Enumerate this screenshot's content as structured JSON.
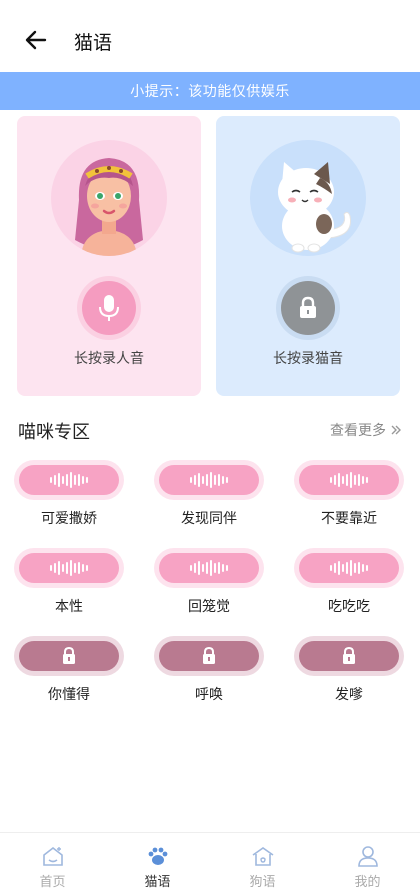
{
  "header": {
    "title": "猫语"
  },
  "tip": "小提示：该功能仅供娱乐",
  "record_cards": [
    {
      "label": "长按录人音",
      "icon": "microphone-icon"
    },
    {
      "label": "长按录猫音",
      "icon": "lock-icon"
    }
  ],
  "section": {
    "title": "喵咪专区",
    "more": "查看更多"
  },
  "sounds": [
    {
      "label": "可爱撒娇",
      "locked": false
    },
    {
      "label": "发现同伴",
      "locked": false
    },
    {
      "label": "不要靠近",
      "locked": false
    },
    {
      "label": "本性",
      "locked": false
    },
    {
      "label": "回笼觉",
      "locked": false
    },
    {
      "label": "吃吃吃",
      "locked": false
    },
    {
      "label": "你懂得",
      "locked": true
    },
    {
      "label": "呼唤",
      "locked": true
    },
    {
      "label": "发嗲",
      "locked": true
    }
  ],
  "tabs": [
    {
      "label": "首页",
      "icon": "home-icon",
      "active": false
    },
    {
      "label": "猫语",
      "icon": "paw-icon",
      "active": true
    },
    {
      "label": "狗语",
      "icon": "dog-house-icon",
      "active": false
    },
    {
      "label": "我的",
      "icon": "user-icon",
      "active": false
    }
  ],
  "colors": {
    "tip_bar": "#7fb2ff",
    "pink": "#f7a3c4",
    "locked": "#b97a90",
    "active_tab": "#333333"
  }
}
